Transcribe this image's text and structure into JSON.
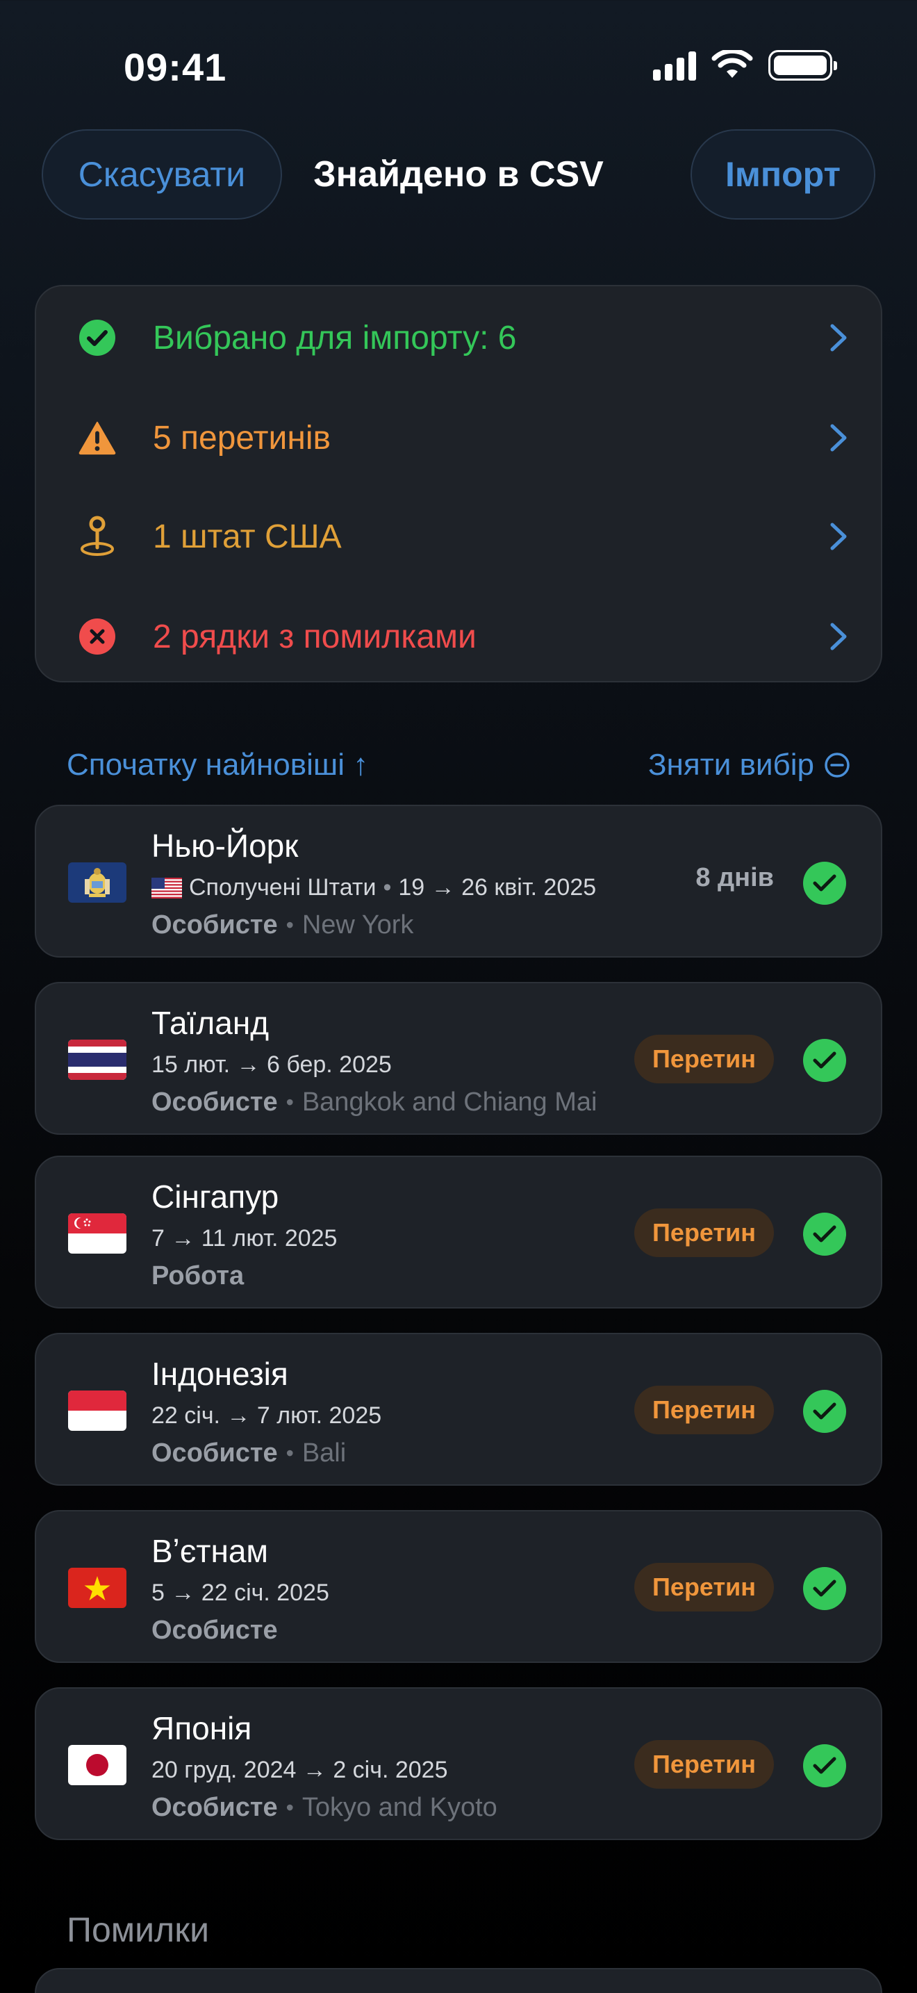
{
  "status_bar": {
    "time": "09:41"
  },
  "nav": {
    "cancel_label": "Скасувати",
    "title": "Знайдено в CSV",
    "import_label": "Імпорт"
  },
  "summary": {
    "selected": "Вибрано для імпорту: 6",
    "overlaps": "5 перетинів",
    "us_states": "1 штат США",
    "errors": "2 рядки з помилками"
  },
  "colors": {
    "accent": "#4a90d9",
    "green": "#34c759",
    "orange": "#f0963c",
    "gold": "#e0a038",
    "red": "#f04c4c"
  },
  "list": {
    "sort_label": "Спочатку найновіші ↑",
    "deselect_label": "Зняти вибір"
  },
  "trips": [
    {
      "name": "Нью-Йорк",
      "country": "Сполучені Штати",
      "dates": "19 → 26 квіт. 2025",
      "category": "Особисте",
      "location": "New York",
      "days": "8 днів"
    },
    {
      "name": "Таїланд",
      "dates": "15 лют. → 6 бер. 2025",
      "category": "Особисте",
      "location": "Bangkok and Chiang Mai",
      "badge": "Перетин"
    },
    {
      "name": "Сінгапур",
      "dates": "7 → 11 лют. 2025",
      "category": "Робота",
      "badge": "Перетин"
    },
    {
      "name": "Індонезія",
      "dates": "22 січ. → 7 лют. 2025",
      "category": "Особисте",
      "location": "Bali",
      "badge": "Перетин"
    },
    {
      "name": "Вʼєтнам",
      "dates": "5 → 22 січ. 2025",
      "category": "Особисте",
      "badge": "Перетин"
    },
    {
      "name": "Японія",
      "dates": "20 груд. 2024 → 2 січ. 2025",
      "category": "Особисте",
      "location": "Tokyo and Kyoto",
      "badge": "Перетин"
    }
  ],
  "errors_section": {
    "title": "Помилки"
  }
}
